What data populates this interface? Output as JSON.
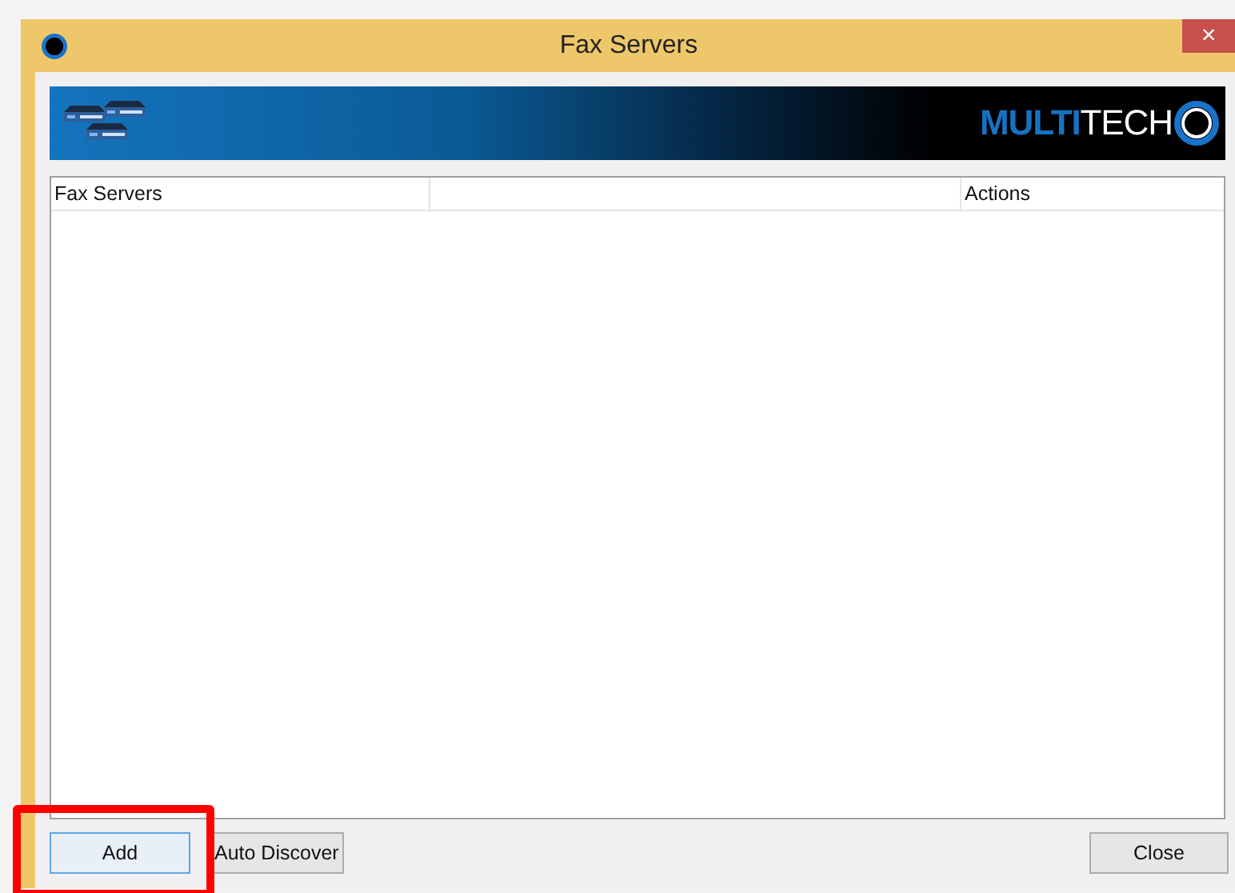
{
  "window": {
    "title": "Fax Servers",
    "close_button": "×"
  },
  "banner": {
    "logo_bold": "MULTI",
    "logo_light": "TECH"
  },
  "table": {
    "columns": [
      "Fax Servers",
      "Actions"
    ]
  },
  "buttons": [
    {
      "label": "Add",
      "focused": true,
      "highlighted": true
    },
    {
      "label": "Auto Discover",
      "focused": false,
      "highlighted": false
    }
  ],
  "close": {
    "label": "Close"
  }
}
